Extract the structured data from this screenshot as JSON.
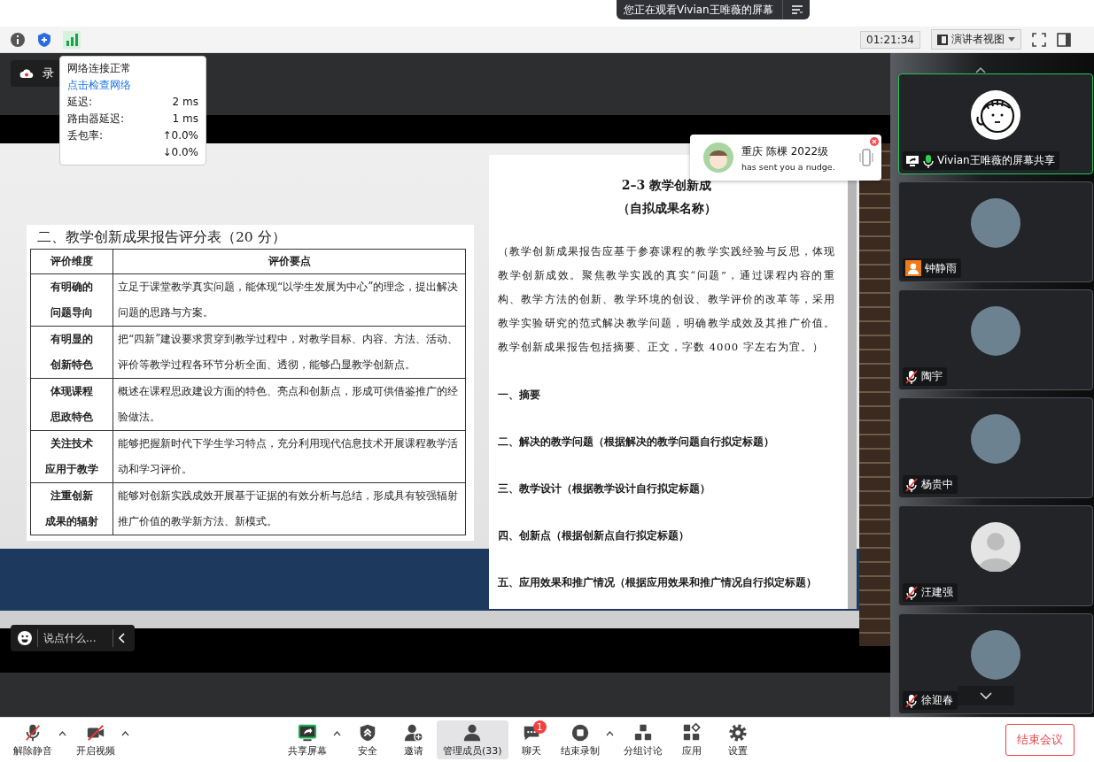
{
  "banner": {
    "text": "您正在观看Vivian王唯薇的屏幕"
  },
  "top_toolbar": {
    "timer": "01:21:34",
    "view_menu": "演讲者视图"
  },
  "recording_badge": {
    "label": "录"
  },
  "network_popup": {
    "status": "网络连接正常",
    "link": "点击检查网络",
    "rows": [
      {
        "label": "延迟:",
        "values": [
          "2 ms"
        ]
      },
      {
        "label": "路由器延迟:",
        "values": [
          "1 ms"
        ]
      },
      {
        "label": "丢包率:",
        "values": [
          "↑0.0%",
          "↓0.0%"
        ]
      }
    ]
  },
  "shared_screen": {
    "score_table": {
      "title": "二、教学创新成果报告评分表（20 分）",
      "columns": [
        "评价维度",
        "评价要点"
      ],
      "rows": [
        {
          "dimension": [
            "有明确的",
            "问题导向"
          ],
          "criteria": "立足于课堂教学真实问题，能体现“以学生发展为中心”的理念，提出解决问题的思路与方案。"
        },
        {
          "dimension": [
            "有明显的",
            "创新特色"
          ],
          "criteria": "把“四新”建设要求贯穿到教学过程中，对教学目标、内容、方法、活动、评价等教学过程各环节分析全面、透彻，能够凸显教学创新点。"
        },
        {
          "dimension": [
            "体现课程",
            "思政特色"
          ],
          "criteria": "概述在课程思政建设方面的特色、亮点和创新点，形成可供借鉴推广的经验做法。"
        },
        {
          "dimension": [
            "关注技术",
            "应用于教学"
          ],
          "criteria": "能够把握新时代下学生学习特点，充分利用现代信息技术开展课程教学活动和学习评价。"
        },
        {
          "dimension": [
            "注重创新",
            "成果的辐射"
          ],
          "criteria": "能够对创新实践成效开展基于证据的有效分析与总结，形成具有较强辐射推广价值的教学新方法、新模式。"
        }
      ]
    },
    "report_page": {
      "title": "2–3 教学创新成",
      "subtitle": "（自拟成果名称）",
      "intro": "（教学创新成果报告应基于参赛课程的教学实践经验与反思，体现教学创新成效。聚焦教学实践的真实“问题”，通过课程内容的重构、教学方法的创新、教学环境的创设、教学评价的改革等，采用教学实验研究的范式解决教学问题，明确教学成效及其推广价值。教学创新成果报告包括摘要、正文，字数 4000 字左右为宜。）",
      "sections": [
        "一、摘要",
        "二、解决的教学问题（根据解决的教学问题自行拟定标题）",
        "三、教学设计（根据教学设计自行拟定标题）",
        "四、创新点（根据创新点自行拟定标题）",
        "五、应用效果和推广情况（根据应用效果和推广情况自行拟定标题）"
      ]
    }
  },
  "nudge": {
    "sender": "重庆 陈棵 2022级",
    "message": "has sent you a nudge."
  },
  "chat_input": {
    "placeholder": "说点什么..."
  },
  "participants": [
    {
      "name": "Vivian王唯薇的屏幕共享",
      "avatar": {
        "kind": "drawing"
      },
      "audio": {
        "kind": "on"
      },
      "sharing": true,
      "active": true
    },
    {
      "name": "钟静雨",
      "avatar": {
        "kind": "photo"
      },
      "audio": {
        "kind": "none"
      },
      "sharing": false,
      "active": false
    },
    {
      "name": "陶宇",
      "avatar": {
        "kind": "photo"
      },
      "audio": {
        "kind": "muted"
      },
      "sharing": false,
      "active": false
    },
    {
      "name": "杨贵中",
      "avatar": {
        "kind": "photo"
      },
      "audio": {
        "kind": "muted"
      },
      "sharing": false,
      "active": false
    },
    {
      "name": "汪建强",
      "avatar": {
        "kind": "silhouette"
      },
      "audio": {
        "kind": "muted"
      },
      "sharing": false,
      "active": false
    },
    {
      "name": "徐迎春",
      "avatar": {
        "kind": "photo"
      },
      "audio": {
        "kind": "muted"
      },
      "sharing": false,
      "active": false
    }
  ],
  "bottom_toolbar": {
    "left": [
      {
        "kind": "mic",
        "label": "解除静音",
        "menu": true
      },
      {
        "kind": "video",
        "label": "开启视频",
        "menu": true
      }
    ],
    "center": [
      {
        "kind": "share",
        "label": "共享屏幕",
        "menu": true,
        "selected": false
      },
      {
        "kind": "security",
        "label": "安全",
        "menu": false,
        "selected": false
      },
      {
        "kind": "invite",
        "label": "邀请",
        "menu": false,
        "selected": false
      },
      {
        "kind": "members",
        "label": "管理成员(33)",
        "menu": false,
        "selected": true
      },
      {
        "kind": "chat",
        "label": "聊天",
        "menu": false,
        "selected": false,
        "badge": "1"
      },
      {
        "kind": "record",
        "label": "结束录制",
        "menu": true,
        "selected": false
      },
      {
        "kind": "breakout",
        "label": "分组讨论",
        "menu": false,
        "selected": false
      },
      {
        "kind": "apps",
        "label": "应用",
        "menu": false,
        "selected": false
      },
      {
        "kind": "settings",
        "label": "设置",
        "menu": false,
        "selected": false
      }
    ],
    "end_button": "结束会议"
  }
}
